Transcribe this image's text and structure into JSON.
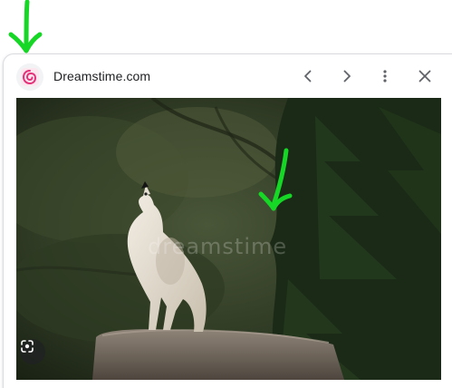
{
  "header": {
    "site_name": "Dreamstime.com",
    "favicon_icon": "dreamstime-swirl-icon",
    "prev_icon": "chevron-left-icon",
    "next_icon": "chevron-right-icon",
    "more_icon": "more-vert-icon",
    "close_icon": "close-icon"
  },
  "image": {
    "watermark": "dreamstime",
    "lens_icon": "google-lens-icon"
  },
  "colors": {
    "favicon_accent": "#e3317a",
    "annotation": "#16d626",
    "icon": "#5f6368",
    "text": "#202124"
  }
}
